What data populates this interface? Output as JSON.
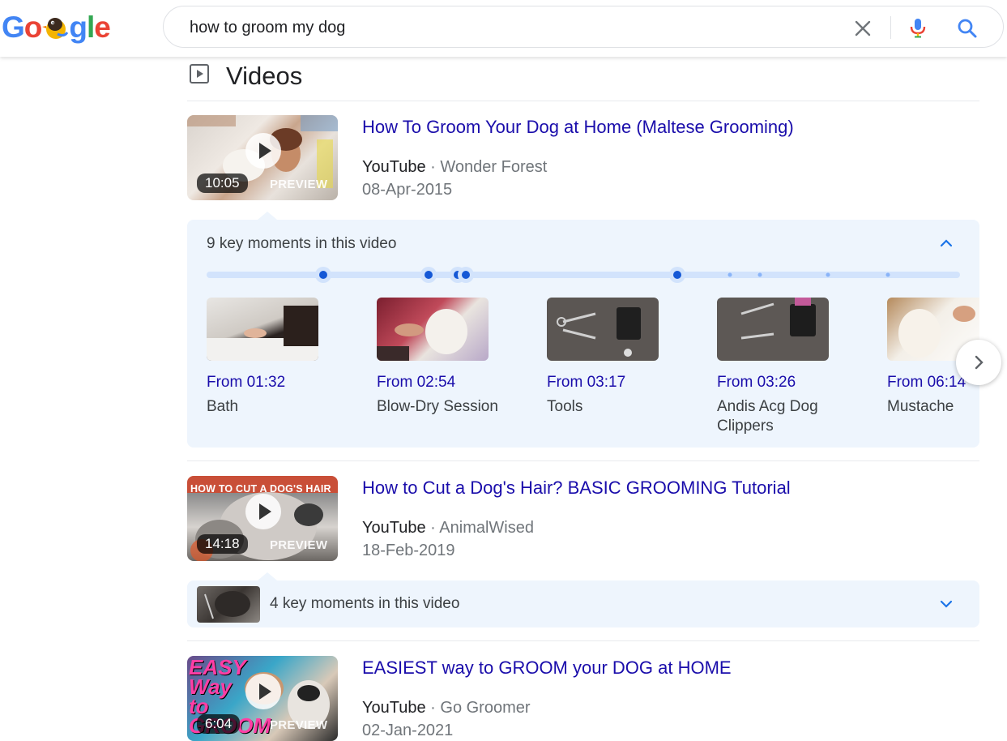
{
  "header": {
    "logo_letters": [
      "G",
      "o",
      "g",
      "l",
      "e"
    ],
    "search_query": "how to groom my dog"
  },
  "section": {
    "title": "Videos"
  },
  "videos": [
    {
      "title": "How To Groom Your Dog at Home (Maltese Grooming)",
      "source": "YouTube",
      "separator": "·",
      "channel": "Wonder Forest",
      "date": "08-Apr-2015",
      "duration": "10:05",
      "preview_label": "PREVIEW"
    },
    {
      "title": "How to Cut a Dog's Hair? BASIC GROOMING Tutorial",
      "source": "YouTube",
      "separator": "·",
      "channel": "AnimalWised",
      "date": "18-Feb-2019",
      "duration": "14:18",
      "preview_label": "PREVIEW",
      "thumb_text": "HOW TO CUT A DOG'S HAIR"
    },
    {
      "title": "EASIEST way to GROOM your DOG at HOME",
      "source": "YouTube",
      "separator": "·",
      "channel": "Go Groomer",
      "date": "02-Jan-2021",
      "duration": "6:04",
      "preview_label": "PREVIEW",
      "thumb_text": "EASY Way to GROOM"
    }
  ],
  "key_moments_1": {
    "heading": "9 key moments in this video",
    "moments": [
      {
        "time": "From 01:32",
        "label": "Bath"
      },
      {
        "time": "From 02:54",
        "label": "Blow-Dry Session"
      },
      {
        "time": "From 03:17",
        "label": "Tools"
      },
      {
        "time": "From 03:26",
        "label": "Andis Acg Dog Clippers"
      },
      {
        "time": "From 06:14",
        "label": "Mustache"
      }
    ]
  },
  "key_moments_2": {
    "heading": "4 key moments in this video"
  },
  "colors": {
    "link": "#1a0dab",
    "panel_bg": "#eef5fd",
    "accent_blue": "#1a73e8"
  }
}
